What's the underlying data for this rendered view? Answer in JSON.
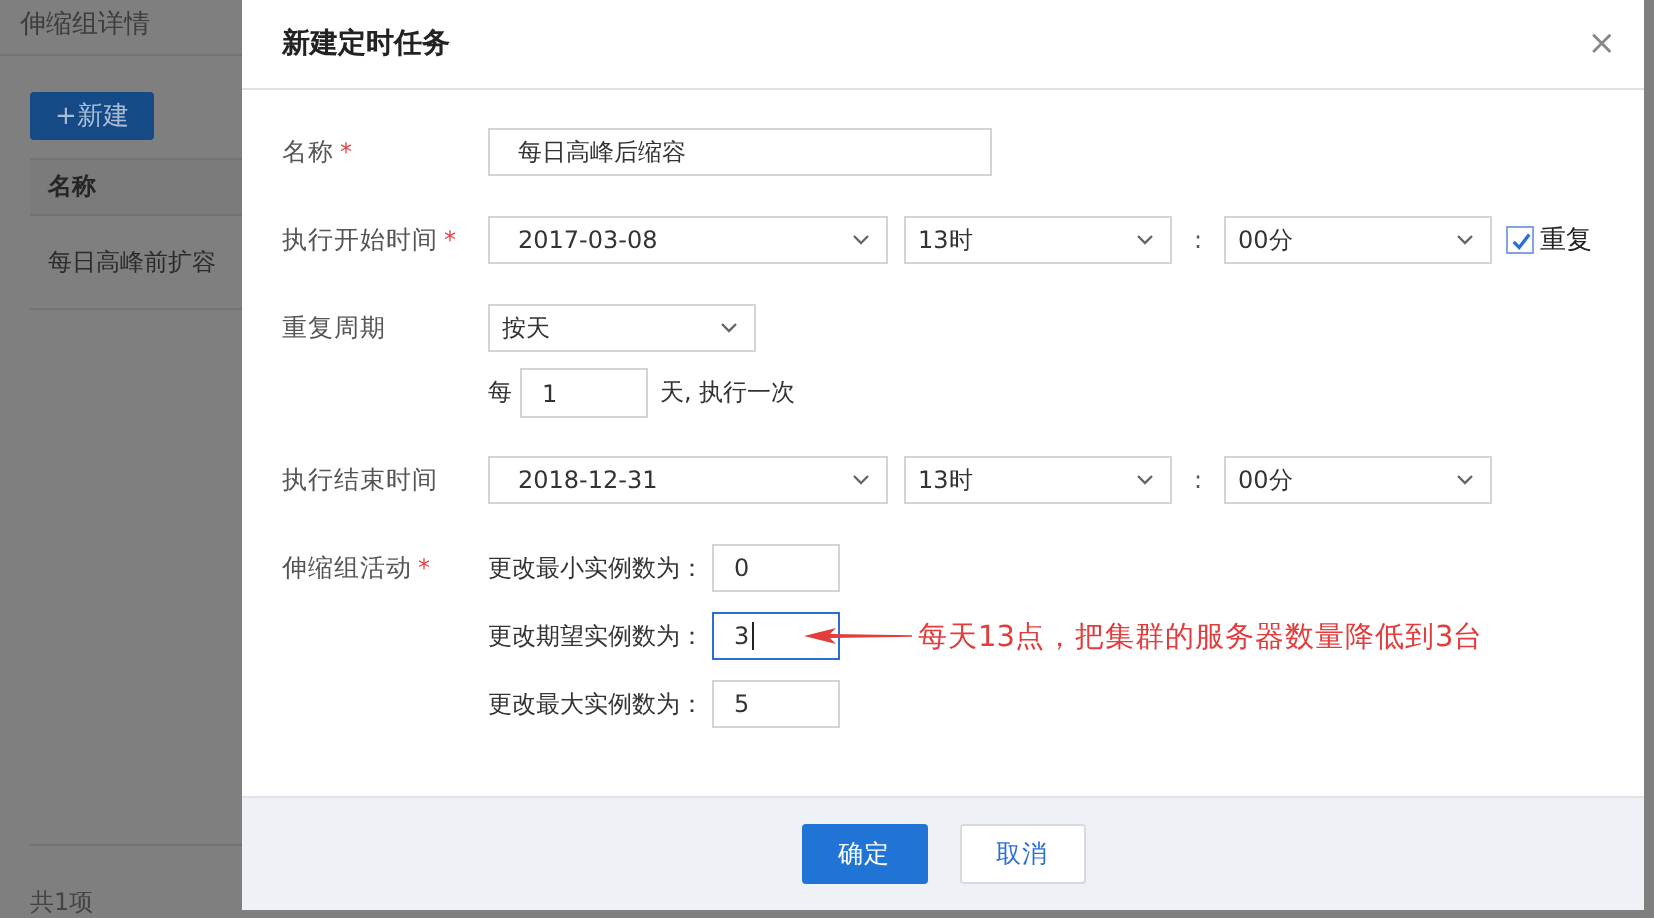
{
  "page": {
    "title": "伸缩组详情",
    "new_button": "+新建",
    "table": {
      "columns": [
        "名称"
      ],
      "rows": [
        [
          "每日高峰前扩容"
        ]
      ]
    },
    "footer": "共1项"
  },
  "dialog": {
    "title": "新建定时任务",
    "close": "×",
    "name": {
      "label": "名称",
      "required_mark": "*",
      "value": "每日高峰后缩容"
    },
    "start": {
      "label": "执行开始时间",
      "required_mark": "*",
      "date": "2017-03-08",
      "hour": "13时",
      "separator": ":",
      "minute": "00分",
      "repeat": {
        "label": "重复",
        "checked": true
      }
    },
    "period": {
      "label": "重复周期",
      "value": "按天",
      "prefix": "每",
      "interval": "1",
      "suffix": "天, 执行一次"
    },
    "end": {
      "label": "执行结束时间",
      "date": "2018-12-31",
      "hour": "13时",
      "separator": ":",
      "minute": "00分"
    },
    "activity": {
      "label": "伸缩组活动",
      "required_mark": "*",
      "items": [
        {
          "label": "更改最小实例数为：",
          "value": "0",
          "focused": false
        },
        {
          "label": "更改期望实例数为：",
          "value": "3",
          "focused": true
        },
        {
          "label": "更改最大实例数为：",
          "value": "5",
          "focused": false
        }
      ]
    },
    "annotation": {
      "text": "每天13点，把集群的服务器数量降低到3台"
    },
    "buttons": [
      {
        "label": "确定",
        "kind": "primary"
      },
      {
        "label": "取消",
        "kind": "secondary"
      }
    ]
  }
}
